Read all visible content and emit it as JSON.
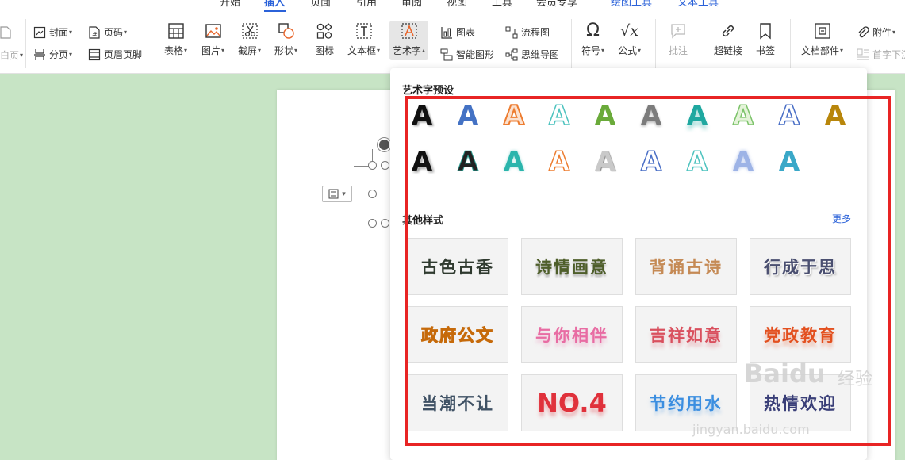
{
  "top_tabs": [
    "开始",
    "插入",
    "页面",
    "引用",
    "审阅",
    "视图",
    "工具",
    "会员专享",
    "绘图工具",
    "文本工具"
  ],
  "ribbon": {
    "left_cut_top": "",
    "left_cut_bottom": "白页",
    "cover": "封面",
    "page_break": "分页",
    "page_num": "页码",
    "header_footer": "页眉页脚",
    "table": "表格",
    "picture": "图片",
    "screenshot": "截屏",
    "shape": "形状",
    "icon": "图标",
    "textbox": "文本框",
    "wordart": "艺术字",
    "chart": "图表",
    "smartart": "智能图形",
    "flowchart": "流程图",
    "mindmap": "思维导图",
    "symbol": "符号",
    "formula": "公式",
    "comment": "批注",
    "hyperlink": "超链接",
    "bookmark": "书签",
    "doc_parts": "文档部件",
    "attachment": "附件",
    "drop_cap": "首字下沉"
  },
  "panel": {
    "presets_title": "艺术字预设",
    "preset_letter": "A",
    "presets": [
      {
        "style": "black-shadow"
      },
      {
        "style": "blue-solid"
      },
      {
        "style": "orange-outline"
      },
      {
        "style": "teal-outline"
      },
      {
        "style": "green-solid"
      },
      {
        "style": "gray-gradient"
      },
      {
        "style": "teal-reflect"
      },
      {
        "style": "lightgreen-outline"
      },
      {
        "style": "blue-double-outline"
      },
      {
        "style": "gold-solid"
      },
      {
        "style": "black-glow"
      },
      {
        "style": "black-teal-outline"
      },
      {
        "style": "teal-gradient"
      },
      {
        "style": "orange-thin-outline"
      },
      {
        "style": "silver-bevel"
      },
      {
        "style": "blue-thin-outline"
      },
      {
        "style": "teal-thin-outline"
      },
      {
        "style": "blue-fade"
      },
      {
        "style": "teal-flat"
      }
    ],
    "other_title": "其他样式",
    "more_label": "更多",
    "cards": [
      {
        "text": "古色古香",
        "color": "#2f3a2f"
      },
      {
        "text": "诗情画意",
        "color": "#4e5e2a"
      },
      {
        "text": "背诵古诗",
        "color": "#c58a55"
      },
      {
        "text": "行成于思",
        "color": "#4a4f70"
      },
      {
        "text": "政府公文",
        "color": "#f0b417"
      },
      {
        "text": "与你相伴",
        "color": "#e86ca3"
      },
      {
        "text": "吉祥如意",
        "color": "#d9505e"
      },
      {
        "text": "党政教育",
        "color": "#e3501f"
      },
      {
        "text": "当潮不让",
        "color": "#3f5164"
      },
      {
        "text": "NO.4",
        "color": "#e0313b"
      },
      {
        "text": "节约用水",
        "color": "#3b8ee0"
      },
      {
        "text": "热情欢迎",
        "color": "#3a3f78"
      }
    ]
  },
  "watermark": {
    "brand": "Baidu",
    "brand_cn": "经验",
    "url": "jingyan.baidu.com"
  },
  "colors": {
    "accent": "#2b62d9",
    "highlight": "#e82424",
    "background": "#c7e4c5"
  }
}
